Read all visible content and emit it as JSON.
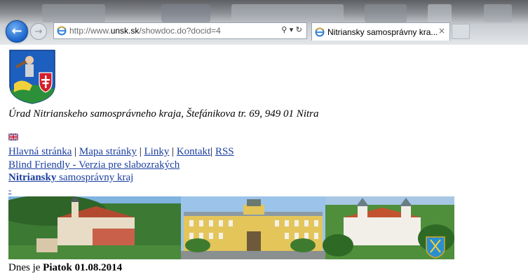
{
  "browser": {
    "url_prefix": "http://www.",
    "url_domain": "unsk.sk",
    "url_path": "/showdoc.do?docid=4",
    "tab_title": "Nitriansky samosprávny kra...",
    "tab_close": "×",
    "search_glyph": "⚲ ▾ ↻",
    "back_glyph": "←",
    "forward_glyph": "→"
  },
  "page": {
    "address": "Úrad Nitrianskeho samosprávneho kraja, Štefánikova tr. 69, 949 01 Nitra",
    "nav": [
      {
        "label": "Hlavná stránka"
      },
      {
        "label": "Mapa stránky"
      },
      {
        "label": "Linky"
      },
      {
        "label": "Kontakt"
      },
      {
        "label": "RSS"
      }
    ],
    "separator": "|",
    "blind_friendly": "Blind Friendly - Verzia pre slabozrakých",
    "region_bold": "Nitriansky",
    "region_rest": " samosprávny kraj",
    "tiny_link": "-",
    "date_prefix": "Dnes je ",
    "date_value": "Piatok 01.08.2014"
  }
}
